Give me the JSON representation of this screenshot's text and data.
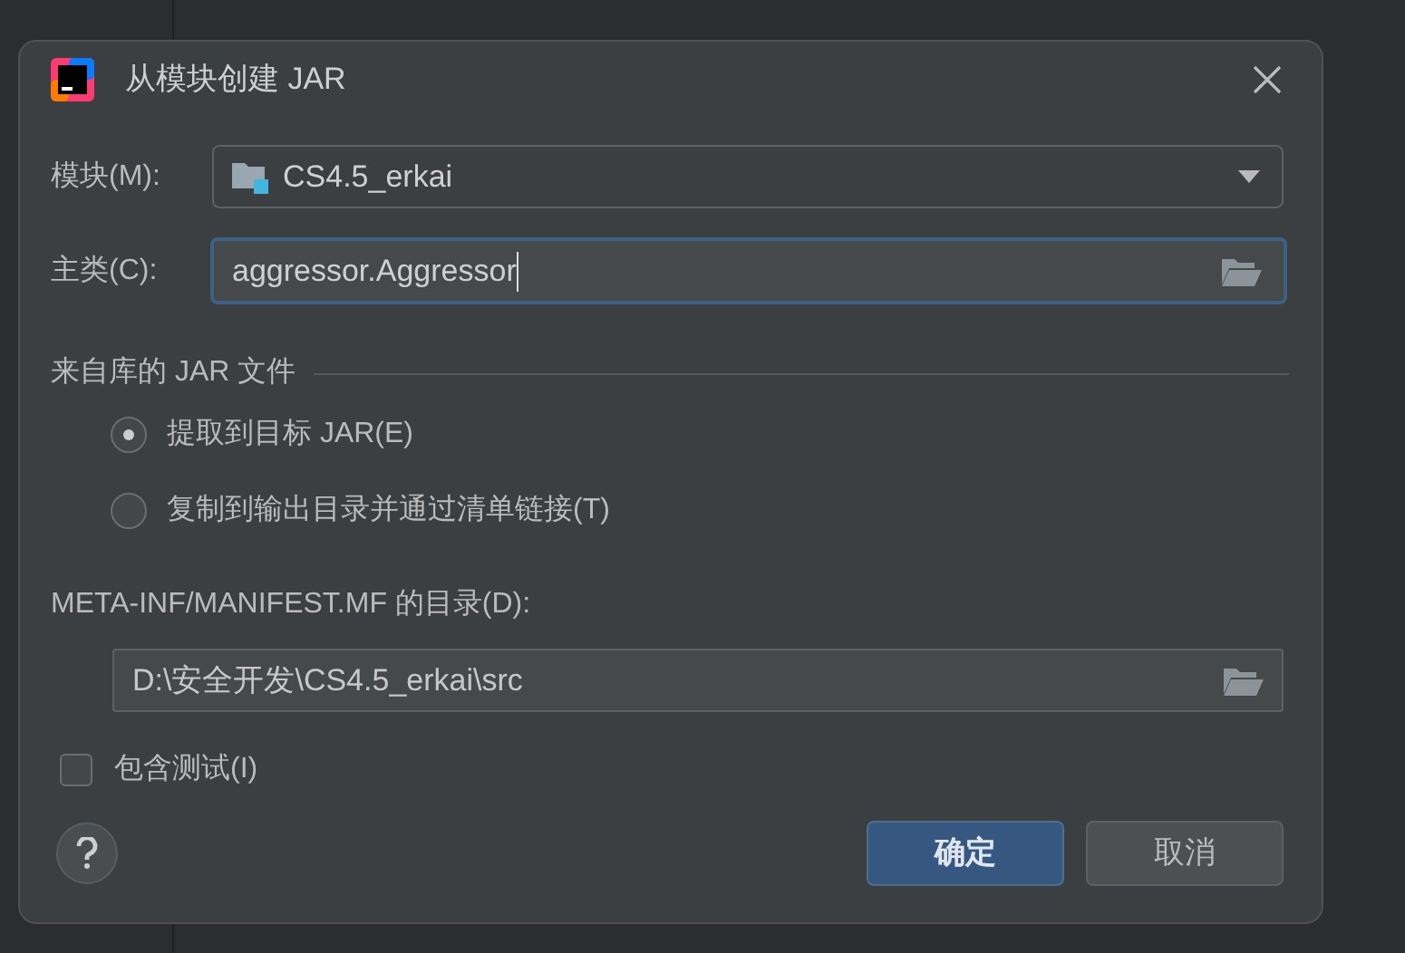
{
  "window": {
    "title": "从模块创建 JAR"
  },
  "module": {
    "label": "模块(M):",
    "value": "CS4.5_erkai"
  },
  "main_class": {
    "label": "主类(C):",
    "value": "aggressor.Aggressor",
    "focused": true
  },
  "library_jars": {
    "title": "来自库的 JAR 文件",
    "options": [
      {
        "label": "提取到目标 JAR(E)",
        "selected": true
      },
      {
        "label": "复制到输出目录并通过清单链接(T)",
        "selected": false
      }
    ]
  },
  "manifest": {
    "label": "META-INF/MANIFEST.MF 的目录(D):",
    "value": "D:\\安全开发\\CS4.5_erkai\\src"
  },
  "include_tests": {
    "label": "包含测试(I)",
    "checked": false
  },
  "buttons": [
    {
      "label": "确定",
      "kind": "primary"
    },
    {
      "label": "取消",
      "kind": "secondary"
    }
  ]
}
